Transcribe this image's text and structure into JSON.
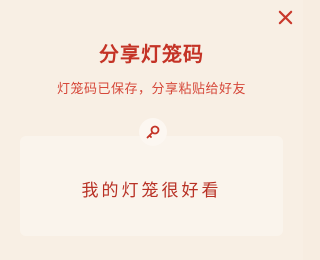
{
  "dialog": {
    "title": "分享灯笼码",
    "subtitle": "灯笼码已保存，分享粘贴给好友",
    "code": "我的灯笼很好看",
    "close_icon": "close-icon",
    "key_icon": "key-icon"
  },
  "colors": {
    "accent": "#c43326",
    "background": "#f8efe4"
  }
}
